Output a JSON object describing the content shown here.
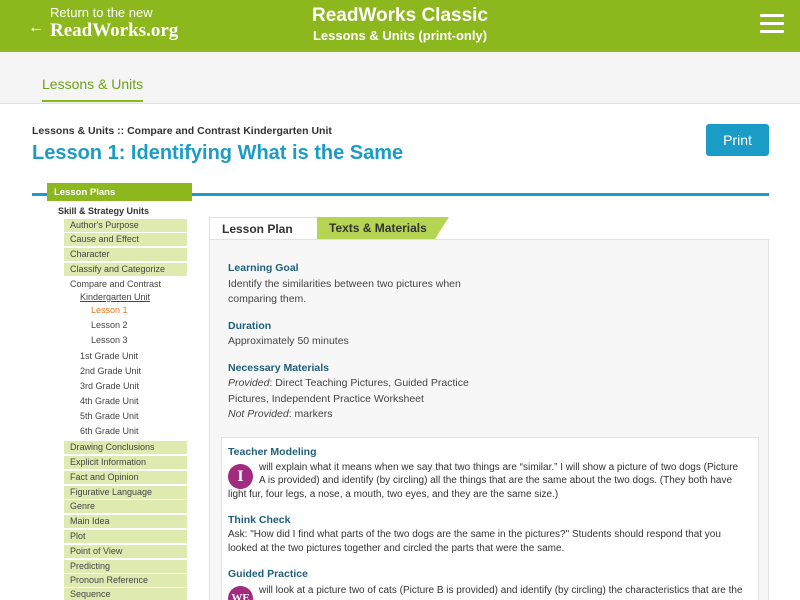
{
  "header": {
    "return_line1": "Return to the new",
    "return_line2": "ReadWorks.org",
    "return_arrow": "←",
    "title": "ReadWorks Classic",
    "subtitle": "Lessons & Units (print-only)",
    "menu_icon": "hamburger-icon",
    "brand_color": "#8db81d"
  },
  "subnav": {
    "lessons_units": "Lessons & Units"
  },
  "breadcrumb": "Lessons & Units :: Compare and Contrast Kindergarten Unit",
  "page_title": "Lesson 1: Identifying What is the Same",
  "print_label": "Print",
  "accent_color": "#1b9cc7",
  "sidebar": {
    "heading": "Lesson Plans",
    "subheading": "Skill & Strategy Units",
    "items_top": [
      "Author's Purpose",
      "Cause and Effect",
      "Character",
      "Classify and Categorize"
    ],
    "compare": "Compare and Contrast",
    "kinder": "Kindergarten Unit",
    "lessons": [
      "Lesson 1",
      "Lesson 2",
      "Lesson 3"
    ],
    "grades": [
      "1st Grade Unit",
      "2nd Grade Unit",
      "3rd Grade Unit",
      "4th Grade Unit",
      "5th Grade Unit",
      "6th Grade Unit"
    ],
    "items_bottom": [
      "Drawing Conclusions",
      "Explicit Information",
      "Fact and Opinion",
      "Figurative Language",
      "Genre",
      "Main Idea",
      "Plot",
      "Point of View",
      "Predicting",
      "Pronoun Reference",
      "Sequence"
    ]
  },
  "tabs": {
    "lesson_plan": "Lesson Plan",
    "texts_materials": "Texts & Materials"
  },
  "content": {
    "goal_h": "Learning Goal",
    "goal_p1": "Identify the similarities between two pictures when",
    "goal_p2": "comparing them.",
    "duration_h": "Duration",
    "duration_p": "Approximately 50 minutes",
    "materials_h": "Necessary Materials",
    "provided_label": "Provided",
    "provided_1": ": Direct Teaching Pictures, Guided Practice",
    "provided_2": "Pictures, Independent Practice Worksheet",
    "not_provided_label": "Not Provided",
    "not_provided": ": markers",
    "teacher_h": "Teacher Modeling",
    "badge_i": "I",
    "teacher_1": "will explain what it means when we say that two things are “similar.” I will show a picture of two dogs (Picture",
    "teacher_2": "A is provided) and identify (by circling) all the things that are the same about the two dogs. (They both have",
    "teacher_3": "light fur, four legs, a nose, a mouth, two eyes, and they are the same size.)",
    "think_h": "Think Check",
    "think_1": "Ask: \"How did I find what parts of the two dogs are the same in the pictures?\" Students should respond that you",
    "think_2": "looked at the two pictures together and circled the parts that were the same.",
    "guided_h": "Guided Practice",
    "badge_we": "WE",
    "guided_1": "will look at a picture two of cats (Picture B is provided) and identify (by circling) the characteristics that are the"
  }
}
